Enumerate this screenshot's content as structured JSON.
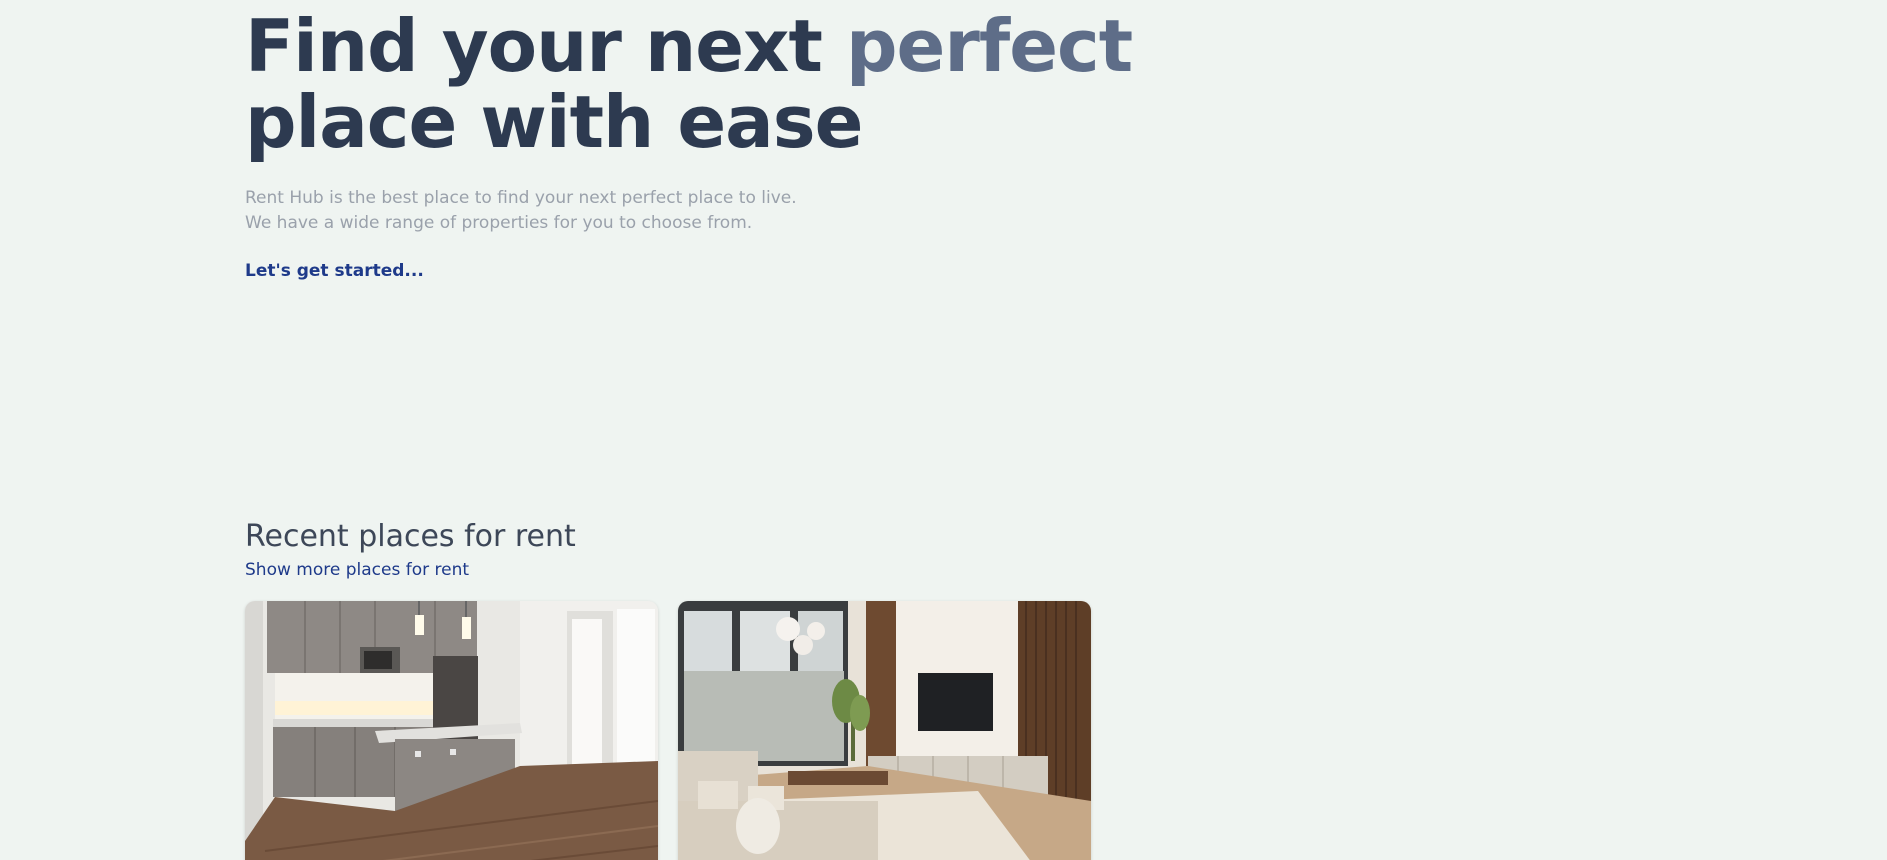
{
  "hero": {
    "title_part1": "Find your next ",
    "title_accent": "perfect",
    "title_part2": "place with ease",
    "subtitle_line1": "Rent Hub is the best place to find your next perfect place to live.",
    "subtitle_line2": "We have a wide range of properties for you to choose from.",
    "cta_label": "Let's get started..."
  },
  "recent": {
    "title": "Recent places for rent",
    "show_more_label": "Show more places for rent"
  },
  "listings": [
    {
      "image": "kitchen-photo"
    },
    {
      "image": "living-room-photo"
    }
  ],
  "colors": {
    "background": "#eff4f1",
    "heading": "#2d3a50",
    "accent": "#5e6d88",
    "link": "#1e3a8a",
    "muted_text": "#9aa1ab"
  }
}
